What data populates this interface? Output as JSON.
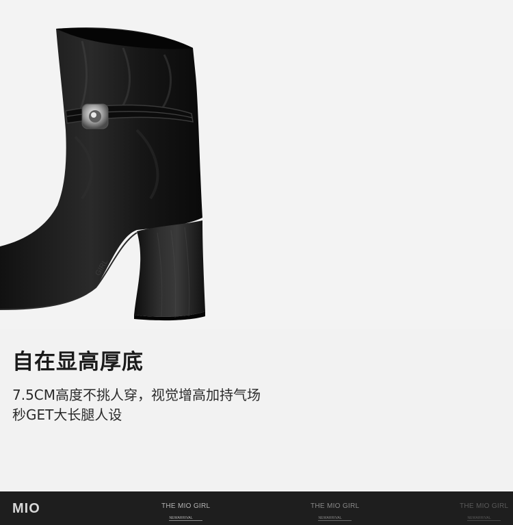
{
  "product_image": {
    "alt_icon": "ankle-boot-photo"
  },
  "headline": "自在显高厚底",
  "description": {
    "line1": "7.5CM高度不挑人穿，视觉增高加持气场",
    "line2": "秒GET大长腿人设"
  },
  "footer": {
    "logo": "MIO",
    "watermarks": [
      {
        "title": "THE MIO GIRL",
        "subtitle": "NEWARRIVAL"
      },
      {
        "title": "THE MIO GIRL",
        "subtitle": "NEWARRIVAL"
      },
      {
        "title": "THE MIO GIRL",
        "subtitle": "NEWARRIVAL"
      }
    ]
  },
  "colors": {
    "background": "#f2f2f2",
    "footer": "#1e1e1e",
    "text": "#1a1a1a"
  }
}
